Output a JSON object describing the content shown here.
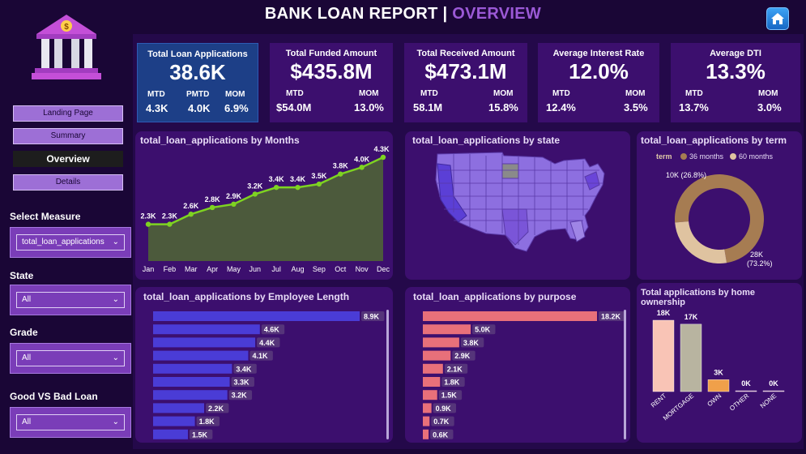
{
  "header": {
    "title_main": "BANK LOAN REPORT | ",
    "title_accent": "OVERVIEW"
  },
  "nav": [
    {
      "label": "Landing Page"
    },
    {
      "label": "Summary"
    },
    {
      "label": "Overview"
    },
    {
      "label": "Details"
    }
  ],
  "filters": {
    "measure": {
      "label": "Select Measure",
      "value": "total_loan_applications"
    },
    "state": {
      "label": "State",
      "value": "All"
    },
    "grade": {
      "label": "Grade",
      "value": "All"
    },
    "goodbad": {
      "label": "Good VS Bad Loan",
      "value": "All"
    }
  },
  "kpis": {
    "apps": {
      "title": "Total Loan Applications",
      "value": "38.6K",
      "l1": "MTD",
      "v1": "4.3K",
      "l2": "PMTD",
      "v2": "4.0K",
      "l3": "MOM",
      "v3": "6.9%"
    },
    "funded": {
      "title": "Total Funded Amount",
      "value": "$435.8M",
      "l1": "MTD",
      "v1": "$54.0M",
      "l2": "MOM",
      "v2": "13.0%"
    },
    "received": {
      "title": "Total Received Amount",
      "value": "$473.1M",
      "l1": "MTD",
      "v1": "58.1M",
      "l2": "MOM",
      "v2": "15.8%"
    },
    "rate": {
      "title": "Average Interest Rate",
      "value": "12.0%",
      "l1": "MTD",
      "v1": "12.4%",
      "l2": "MOM",
      "v2": "3.5%"
    },
    "dti": {
      "title": "Average DTI",
      "value": "13.3%",
      "l1": "MTD",
      "v1": "13.7%",
      "l2": "MOM",
      "v2": "3.0%"
    }
  },
  "panels": {
    "months": "total_loan_applications by Months",
    "state": "total_loan_applications by state",
    "term": "total_loan_applications by term",
    "emp": "total_loan_applications by Employee Length",
    "purpose": "total_loan_applications by purpose",
    "home": "Total applications by home ownership"
  },
  "colors": {
    "accent": "#9b59d6",
    "line": "#7ed321",
    "area": "#4c5a3c",
    "emp_bar": "#4a3cd6",
    "purpose_bar": "#e8707a",
    "term36": "#a67c52",
    "term60": "#dfc3a0"
  },
  "chart_data": [
    {
      "type": "area",
      "categories": [
        "Jan",
        "Feb",
        "Mar",
        "Apr",
        "May",
        "Jun",
        "Jul",
        "Aug",
        "Sep",
        "Oct",
        "Nov",
        "Dec"
      ],
      "values": [
        2.3,
        2.3,
        2.6,
        2.8,
        2.9,
        3.2,
        3.4,
        3.4,
        3.5,
        3.8,
        4.0,
        4.3
      ],
      "labels": [
        "2.3K",
        "2.3K",
        "2.6K",
        "2.8K",
        "2.9K",
        "3.2K",
        "3.4K",
        "3.4K",
        "3.5K",
        "3.8K",
        "4.0K",
        "4.3K"
      ],
      "title": "total_loan_applications by Months"
    },
    {
      "type": "pie",
      "title": "total_loan_applications by term",
      "legend_title": "term",
      "categories": [
        "36 months",
        "60 months"
      ],
      "values": [
        28,
        10
      ],
      "labels": [
        "28K (73.2%)",
        "10K (26.8%)"
      ]
    },
    {
      "type": "bar",
      "title": "total_loan_applications by Employee Length",
      "values": [
        8.9,
        4.6,
        4.4,
        4.1,
        3.4,
        3.3,
        3.2,
        2.2,
        1.8,
        1.5
      ],
      "labels": [
        "8.9K",
        "4.6K",
        "4.4K",
        "4.1K",
        "3.4K",
        "3.3K",
        "3.2K",
        "2.2K",
        "1.8K",
        "1.5K"
      ]
    },
    {
      "type": "bar",
      "title": "total_loan_applications by purpose",
      "values": [
        18.2,
        5.0,
        3.8,
        2.9,
        2.1,
        1.8,
        1.5,
        0.9,
        0.7,
        0.6
      ],
      "labels": [
        "18.2K",
        "5.0K",
        "3.8K",
        "2.9K",
        "2.1K",
        "1.8K",
        "1.5K",
        "0.9K",
        "0.7K",
        "0.6K"
      ]
    },
    {
      "type": "bar",
      "title": "Total applications by home ownership",
      "categories": [
        "RENT",
        "MORTGAGE",
        "OWN",
        "OTHER",
        "NONE"
      ],
      "values": [
        18,
        17,
        3,
        0.1,
        0.01
      ],
      "labels": [
        "18K",
        "17K",
        "3K",
        "0K",
        "0K"
      ],
      "colors": [
        "#f9c4b6",
        "#b8b4a0",
        "#f0a04a",
        "#d0a0c0",
        "#d0a0c0"
      ]
    }
  ]
}
